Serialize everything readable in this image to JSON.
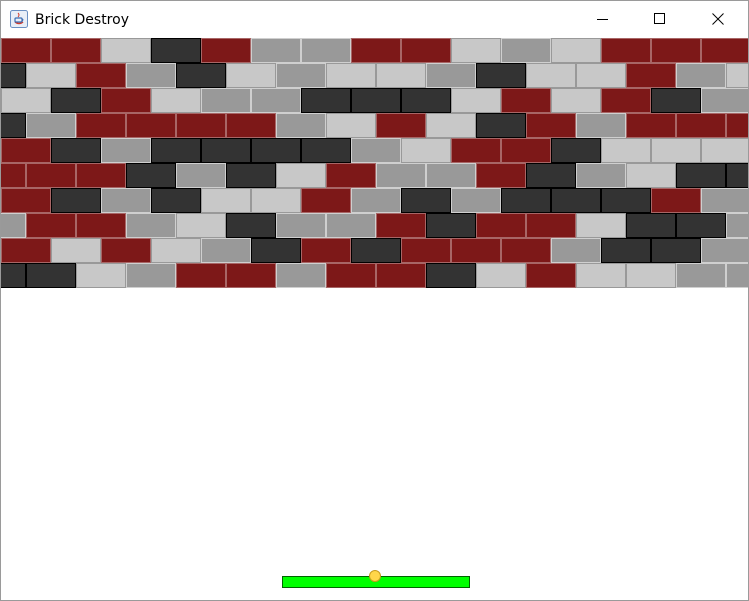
{
  "window": {
    "title": "Brick Destroy",
    "icons": {
      "app": "java-app-icon",
      "minimize": "minimize-icon",
      "maximize": "maximize-icon",
      "close": "close-icon"
    }
  },
  "colors": {
    "red_brick": "#7d1818",
    "light_brick": "#c8c8c8",
    "gray_brick": "#999999",
    "dark_brick": "#333333",
    "paddle": "#00ff00",
    "paddle_border": "#006400",
    "ball": "#ffd64a",
    "ball_border": "#c89b1d"
  },
  "bricks": {
    "rows": [
      [
        "R",
        "R",
        "L",
        "D",
        "R",
        "G",
        "G",
        "R",
        "R",
        "L",
        "G",
        "L",
        "R",
        "R",
        "R"
      ],
      [
        "D",
        "L",
        "R",
        "G",
        "D",
        "L",
        "G",
        "L",
        "L",
        "G",
        "D",
        "L",
        "L",
        "R",
        "G",
        "L"
      ],
      [
        "L",
        "D",
        "R",
        "L",
        "G",
        "G",
        "D",
        "D",
        "D",
        "L",
        "R",
        "L",
        "R",
        "D",
        "G"
      ],
      [
        "D",
        "G",
        "R",
        "R",
        "R",
        "R",
        "G",
        "L",
        "R",
        "L",
        "D",
        "R",
        "G",
        "R",
        "R",
        "R"
      ],
      [
        "R",
        "D",
        "G",
        "D",
        "D",
        "D",
        "D",
        "G",
        "L",
        "R",
        "R",
        "D",
        "L",
        "L",
        "L"
      ],
      [
        "R",
        "R",
        "R",
        "D",
        "G",
        "D",
        "L",
        "R",
        "G",
        "G",
        "R",
        "D",
        "G",
        "L",
        "D",
        "D"
      ],
      [
        "R",
        "D",
        "G",
        "D",
        "L",
        "L",
        "R",
        "G",
        "D",
        "G",
        "D",
        "D",
        "D",
        "R",
        "G"
      ],
      [
        "G",
        "R",
        "R",
        "G",
        "L",
        "D",
        "G",
        "G",
        "R",
        "D",
        "R",
        "R",
        "L",
        "D",
        "D",
        "G"
      ],
      [
        "R",
        "L",
        "R",
        "L",
        "G",
        "D",
        "R",
        "D",
        "R",
        "R",
        "R",
        "G",
        "D",
        "D",
        "G"
      ],
      [
        "D",
        "D",
        "L",
        "G",
        "R",
        "R",
        "G",
        "R",
        "R",
        "D",
        "L",
        "R",
        "L",
        "L",
        "G",
        "G"
      ]
    ]
  }
}
